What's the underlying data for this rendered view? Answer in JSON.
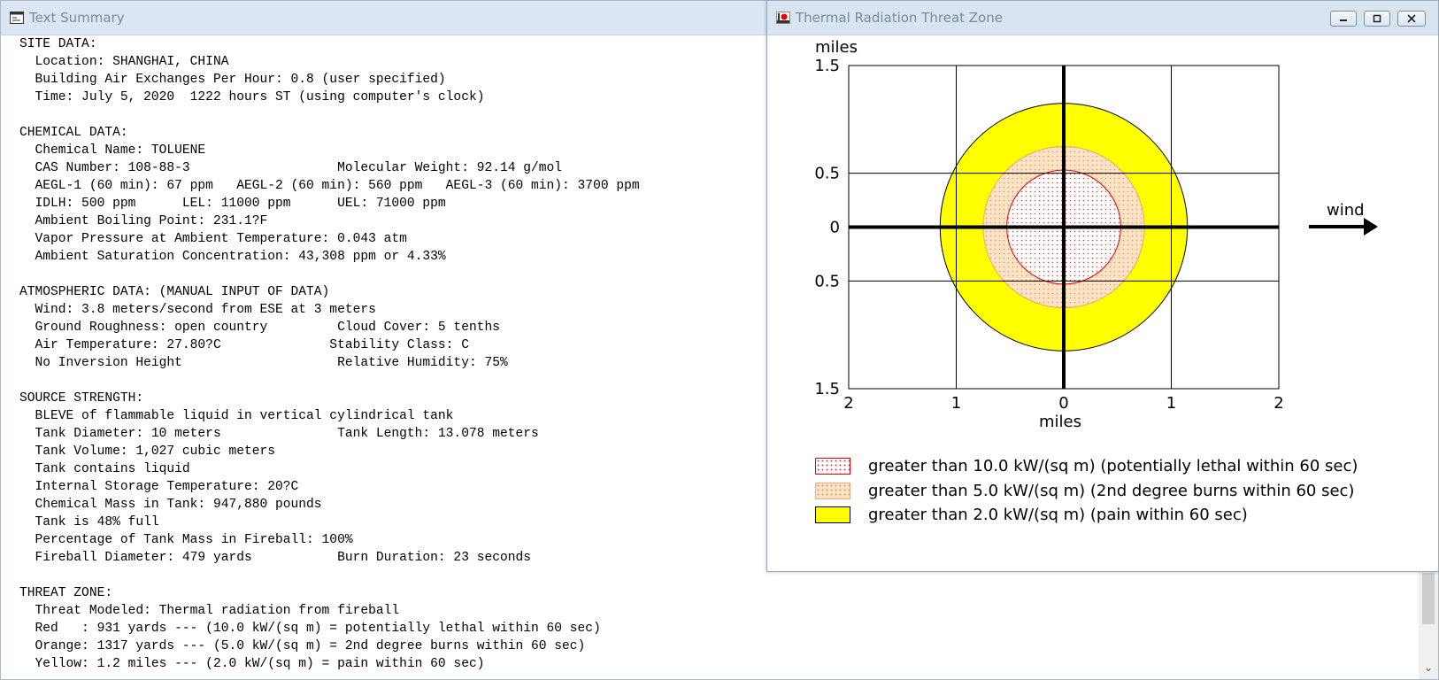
{
  "summary_window": {
    "title": "Text Summary",
    "lines": [
      "SITE DATA:",
      "  Location: SHANGHAI, CHINA",
      "  Building Air Exchanges Per Hour: 0.8 (user specified)",
      "  Time: July 5, 2020  1222 hours ST (using computer's clock)",
      "",
      "CHEMICAL DATA:",
      "  Chemical Name: TOLUENE",
      "  CAS Number: 108-88-3                   Molecular Weight: 92.14 g/mol",
      "  AEGL-1 (60 min): 67 ppm   AEGL-2 (60 min): 560 ppm   AEGL-3 (60 min): 3700 ppm",
      "  IDLH: 500 ppm      LEL: 11000 ppm      UEL: 71000 ppm",
      "  Ambient Boiling Point: 231.1?F",
      "  Vapor Pressure at Ambient Temperature: 0.043 atm",
      "  Ambient Saturation Concentration: 43,308 ppm or 4.33%",
      "",
      "ATMOSPHERIC DATA: (MANUAL INPUT OF DATA)",
      "  Wind: 3.8 meters/second from ESE at 3 meters",
      "  Ground Roughness: open country         Cloud Cover: 5 tenths",
      "  Air Temperature: 27.80?C              Stability Class: C",
      "  No Inversion Height                    Relative Humidity: 75%",
      "",
      "SOURCE STRENGTH:",
      "  BLEVE of flammable liquid in vertical cylindrical tank",
      "  Tank Diameter: 10 meters               Tank Length: 13.078 meters",
      "  Tank Volume: 1,027 cubic meters",
      "  Tank contains liquid",
      "  Internal Storage Temperature: 20?C",
      "  Chemical Mass in Tank: 947,880 pounds",
      "  Tank is 48% full",
      "  Percentage of Tank Mass in Fireball: 100%",
      "  Fireball Diameter: 479 yards           Burn Duration: 23 seconds",
      "",
      "THREAT ZONE:",
      "  Threat Modeled: Thermal radiation from fireball",
      "  Red   : 931 yards --- (10.0 kW/(sq m) = potentially lethal within 60 sec)",
      "  Orange: 1317 yards --- (5.0 kW/(sq m) = 2nd degree burns within 60 sec)",
      "  Yellow: 1.2 miles --- (2.0 kW/(sq m) = pain within 60 sec)"
    ]
  },
  "threat_window": {
    "title": "Thermal Radiation Threat Zone",
    "buttons": {
      "minimize": "minimize",
      "maximize": "maximize",
      "close": "close"
    },
    "wind_label": "wind",
    "legend": [
      {
        "label": "greater than 10.0 kW/(sq m) (potentially lethal within 60 sec)",
        "color": "#ff0000"
      },
      {
        "label": "greater than 5.0 kW/(sq m) (2nd degree burns within 60 sec)",
        "color": "#fbe3c7"
      },
      {
        "label": "greater than 2.0 kW/(sq m) (pain within 60 sec)",
        "color": "#ffff00"
      }
    ]
  },
  "chart_data": {
    "type": "area",
    "xlabel": "miles",
    "ylabel": "miles",
    "xlim": [
      -2,
      2
    ],
    "ylim": [
      -1.5,
      1.5
    ],
    "x_ticks": [
      -2,
      -1,
      0,
      1,
      2
    ],
    "x_tick_labels": [
      "2",
      "1",
      "0",
      "1",
      "2"
    ],
    "y_ticks": [
      1.5,
      0.5,
      0,
      -0.5,
      -1.5
    ],
    "y_tick_labels": [
      "1.5",
      "0.5",
      "0",
      "0.5",
      "1.5"
    ],
    "grid": true,
    "zones": [
      {
        "name": "Yellow",
        "radius_miles": 1.15,
        "color": "#ffff00"
      },
      {
        "name": "Orange",
        "radius_miles": 0.75,
        "color": "#fbe3c7"
      },
      {
        "name": "Red",
        "radius_miles": 0.53,
        "color": "#ff0000"
      }
    ]
  }
}
